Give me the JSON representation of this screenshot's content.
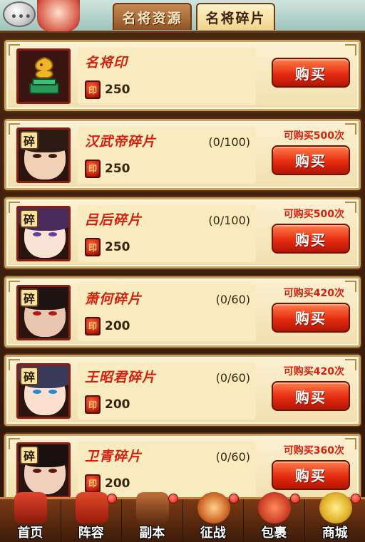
{
  "tabs": [
    {
      "label": "名将资源",
      "active": false
    },
    {
      "label": "名将碎片",
      "active": true
    }
  ],
  "items": [
    {
      "name": "名将印",
      "count": "",
      "price": "250",
      "limit": "",
      "buy_label": "购买",
      "icon": "seal-icon",
      "portrait_color": "#d4a23a",
      "hair_color": "#3a2a1a"
    },
    {
      "name": "汉武帝碎片",
      "count": "(0/100)",
      "price": "250",
      "limit": "可购买500次",
      "buy_label": "购买",
      "icon": "hanwudi-portrait-icon",
      "badge": "碎",
      "portrait_color": "#f2d0b6",
      "hair_color": "#2a1a12"
    },
    {
      "name": "吕后碎片",
      "count": "(0/100)",
      "price": "250",
      "limit": "可购买500次",
      "buy_label": "购买",
      "icon": "lvhou-portrait-icon",
      "badge": "碎",
      "portrait_color": "#fbe3d4",
      "hair_color": "#4a2a5a"
    },
    {
      "name": "萧何碎片",
      "count": "(0/60)",
      "price": "200",
      "limit": "可购买420次",
      "buy_label": "购买",
      "icon": "xiaohe-portrait-icon",
      "badge": "碎",
      "portrait_color": "#e8c6b0",
      "hair_color": "#1e1414"
    },
    {
      "name": "王昭君碎片",
      "count": "(0/60)",
      "price": "200",
      "limit": "可购买420次",
      "buy_label": "购买",
      "icon": "wangzhaojun-portrait-icon",
      "badge": "碎",
      "portrait_color": "#fbe0d0",
      "hair_color": "#3a3a5a"
    },
    {
      "name": "卫青碎片",
      "count": "(0/60)",
      "price": "200",
      "limit": "可购买360次",
      "buy_label": "购买",
      "icon": "weiqing-portrait-icon",
      "badge": "碎",
      "portrait_color": "#f0d0bc",
      "hair_color": "#1a1010"
    }
  ],
  "nav": [
    {
      "label": "首页",
      "icon": "home-icon",
      "color": "#c23020",
      "dot": false
    },
    {
      "label": "阵容",
      "icon": "lineup-icon",
      "color": "#b52a1e",
      "dot": true
    },
    {
      "label": "副本",
      "icon": "dungeon-icon",
      "color": "#8a4a20",
      "dot": true
    },
    {
      "label": "征战",
      "icon": "campaign-icon",
      "color": "#d06a2a",
      "dot": true
    },
    {
      "label": "包裹",
      "icon": "bag-icon",
      "color": "#d0442a",
      "dot": true
    },
    {
      "label": "商城",
      "icon": "shop-icon",
      "color": "#e0b02a",
      "dot": true
    }
  ],
  "colors": {
    "accent_red": "#d5200e",
    "buy_button": "#e62c10",
    "panel_bg": "#fbf1d2"
  }
}
